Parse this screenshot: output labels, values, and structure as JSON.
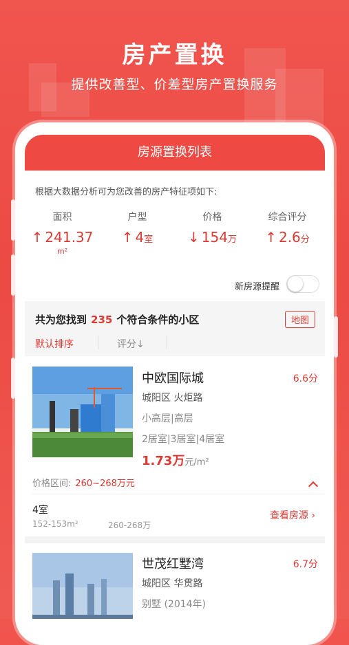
{
  "hero": {
    "title": "房产置换",
    "subtitle": "提供改善型、价差型房产置换服务"
  },
  "screen": {
    "header": "房源置换列表",
    "intro": "根据大数据分析可为您改善的房产特征项如下:",
    "metrics": [
      {
        "label": "面积",
        "arrow": "↑",
        "value": "241.37",
        "unit": "",
        "sub": "m²"
      },
      {
        "label": "户型",
        "arrow": "↑",
        "value": "4",
        "unit": "室",
        "sub": ""
      },
      {
        "label": "价格",
        "arrow": "↓",
        "value": "154",
        "unit": "万",
        "sub": ""
      },
      {
        "label": "综合评分",
        "arrow": "↑",
        "value": "2.6",
        "unit": "分",
        "sub": ""
      }
    ],
    "alert": {
      "label": "新房源提醒",
      "on": false
    },
    "results": {
      "prefix": "共为您找到",
      "count": "235",
      "suffix": "个符合条件的小区",
      "map": "地图"
    },
    "sort": {
      "default": "默认排序",
      "score": "评分↓"
    },
    "listings": [
      {
        "name": "中欧国际城",
        "score": "6.6分",
        "location": "城阳区 火炬路",
        "type": "小高层|高层",
        "rooms": "2居室|3居室|4居室",
        "price": "1.73万",
        "price_unit": "元/m²",
        "range_label": "价格区间:",
        "range_value": "260~268万元",
        "sub": {
          "room": "4室",
          "area": "152-153m²",
          "price": "260-268万",
          "view": "查看房源 ›"
        }
      },
      {
        "name": "世茂红墅湾",
        "score": "6.7分",
        "location": "城阳区 华贯路",
        "type": "别墅 (2014年)"
      }
    ]
  },
  "colors": {
    "brand_red": "#ee4a43",
    "accent_red": "#d93a33"
  }
}
